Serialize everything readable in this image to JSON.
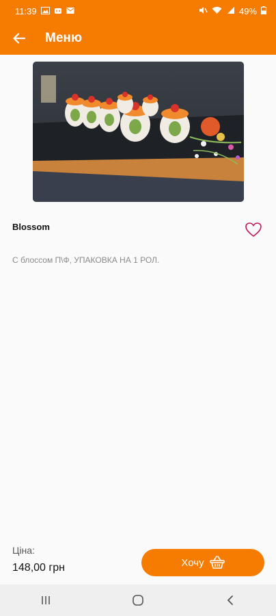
{
  "status_bar": {
    "time": "11:39",
    "battery": "49%"
  },
  "app_bar": {
    "title": "Меню"
  },
  "product": {
    "name": "Blossom",
    "description": "С блоссом П\\Ф, УПАКОВКА НА 1 РОЛ."
  },
  "footer": {
    "price_label": "Ціна:",
    "price_value": "148,00 грн",
    "want_label": "Хочу"
  },
  "colors": {
    "accent": "#f57c00",
    "favorite": "#c2185b"
  }
}
